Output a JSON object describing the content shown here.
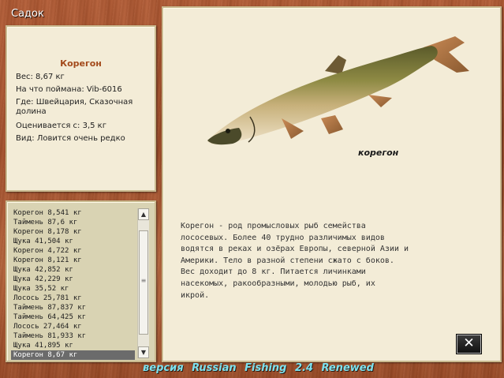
{
  "window": {
    "title": "Садок"
  },
  "info": {
    "fish_name": "Корегон",
    "weight": "Вес: 8,67 кг",
    "bait": "На что поймана: Vib-6016",
    "where": "Где: Швейцария, Сказочная долина",
    "value": "Оценивается с: 3,5 кг",
    "type": "Вид: Ловится очень редко"
  },
  "catch_list": [
    "Корегон 8,541 кг",
    "Таймень 87,6 кг",
    "Корегон 8,178 кг",
    "Щука 41,504 кг",
    "Корегон 4,722 кг",
    "Корегон 8,121 кг",
    "Щука 42,852 кг",
    "Щука 42,229 кг",
    "Щука 35,52 кг",
    "Лосось 25,781 кг",
    "Таймень 87,837 кг",
    "Таймень 64,425 кг",
    "Лосось 27,464 кг",
    "Таймень 81,933 кг",
    "Щука 41,895 кг",
    "Корегон 8,67 кг"
  ],
  "selected_index": 15,
  "picture": {
    "caption": "корегон",
    "icon": "fish-illustration"
  },
  "description": "Корегон - род промысловых рыб семейства\nлососевых. Более 40 трудно различимых видов\nводятся в реках и озёрах Европы, северной Азии и\nАмерики. Тело в разной степени сжато с боков.\nВес доходит до 8 кг. Питается личинками\nнасекомых, ракообразными, молодью рыб, их\nикрой.",
  "close": {
    "symbol": "✕",
    "icon": "close-icon"
  },
  "footer": "версия Russian Fishing 2.4 Renewed",
  "colors": {
    "background": "#a85530",
    "panel": "#f3ecd7",
    "fish_name": "#a34a1b",
    "footer": "#7de1ee"
  }
}
